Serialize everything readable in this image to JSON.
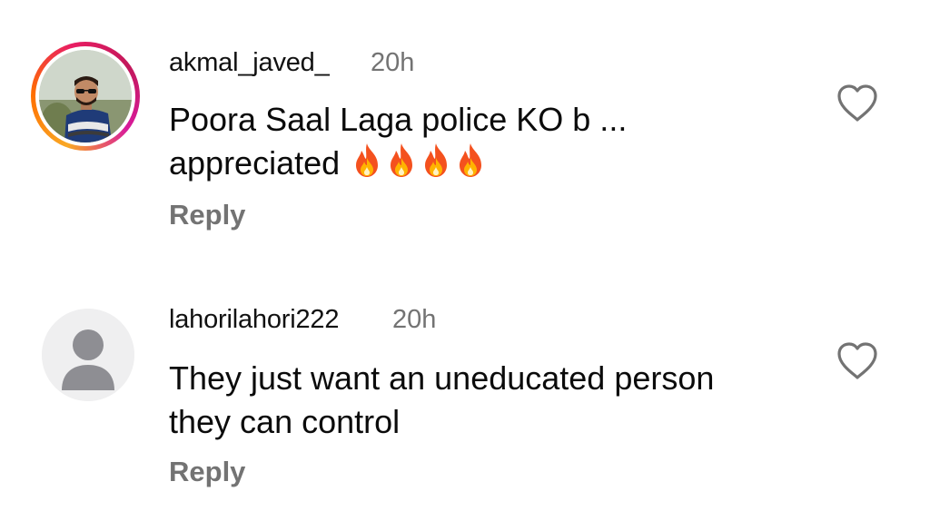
{
  "comments": [
    {
      "username": "akmal_javed_",
      "time": "20h",
      "text_line1": "Poora Saal Laga police KO b ...",
      "text_line2": "appreciated",
      "emoji_icons": [
        "fire-icon",
        "fire-icon",
        "fire-icon",
        "fire-icon"
      ],
      "reply_label": "Reply",
      "avatar": "user-photo",
      "has_story_ring": true,
      "liked": false
    },
    {
      "username": "lahorilahori222",
      "time": "20h",
      "text_line1": "They just want an uneducated person",
      "text_line2": "they can control",
      "reply_label": "Reply",
      "avatar": "default-person-icon",
      "has_story_ring": false,
      "liked": false
    }
  ],
  "colors": {
    "text": "#0b0b0b",
    "secondary": "#737373",
    "story_ring": [
      "#f9a825",
      "#e91e63",
      "#d81b9c"
    ]
  }
}
